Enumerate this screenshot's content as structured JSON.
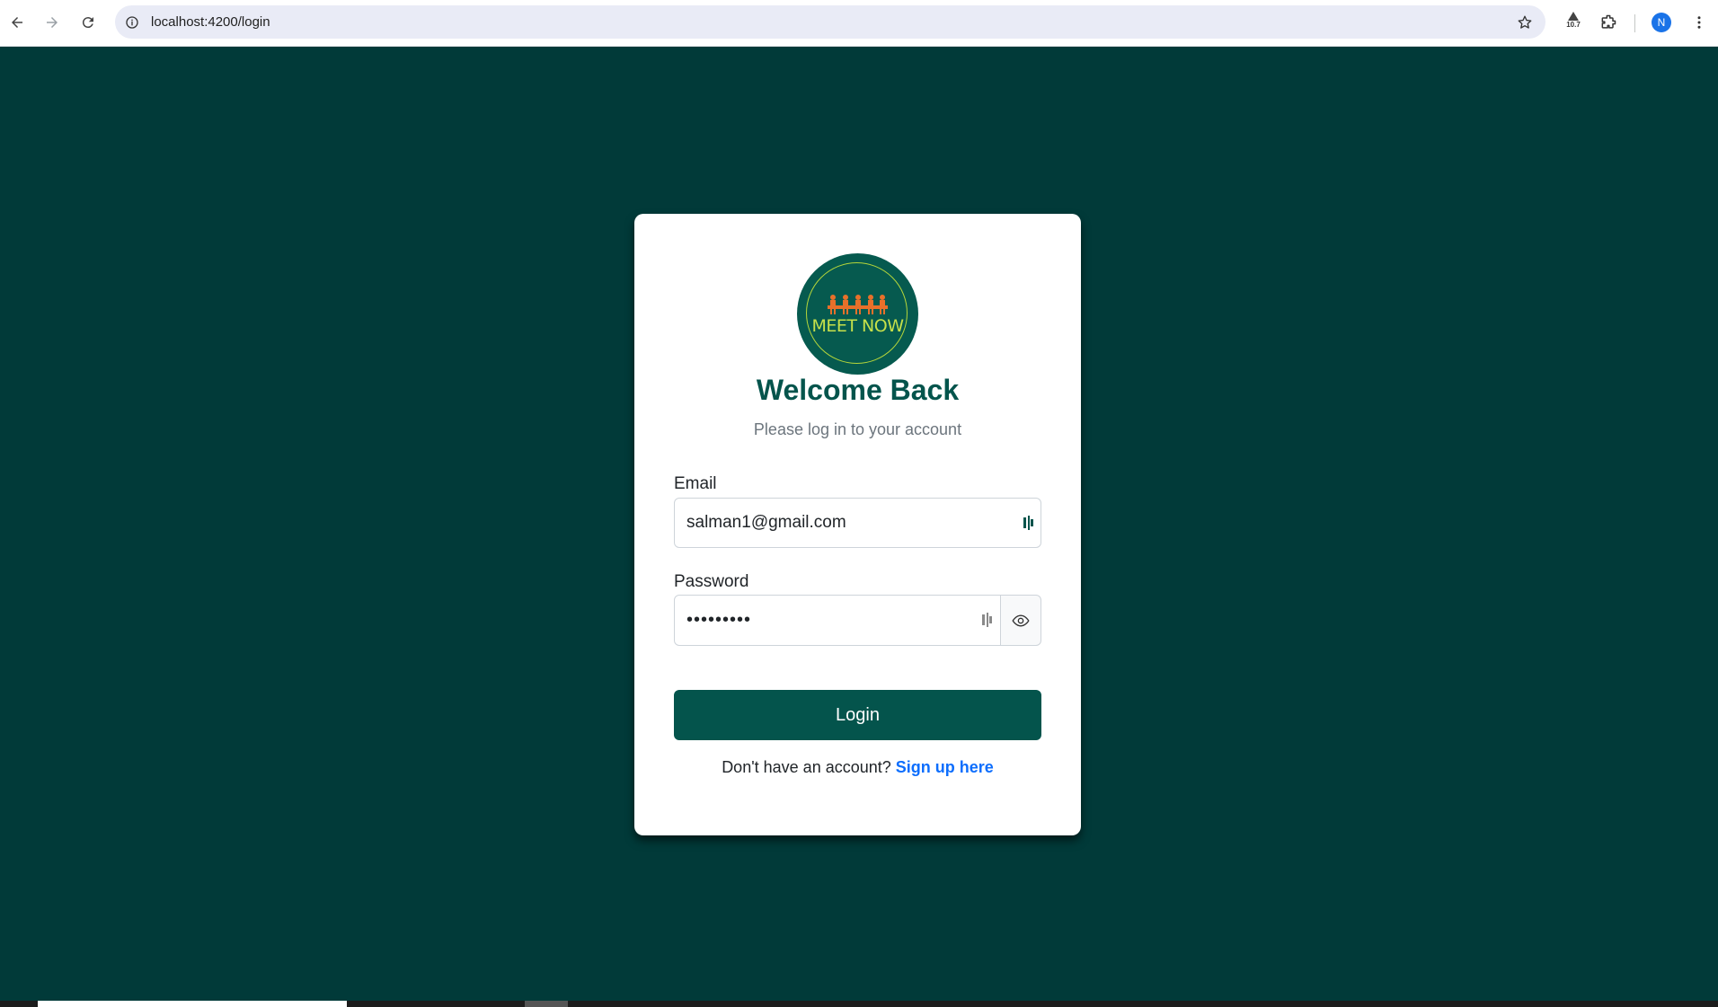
{
  "browser": {
    "url": "localhost:4200/login",
    "extension_badge": "10.7",
    "profile_initial": "N"
  },
  "logo": {
    "text": "MEET NOW"
  },
  "login": {
    "title": "Welcome Back",
    "subtitle": "Please log in to your account",
    "email_label": "Email",
    "email_value": "salman1@gmail.com",
    "password_label": "Password",
    "password_value": "•••••••••",
    "login_button": "Login",
    "signup_prompt": "Don't have an account?",
    "signup_link": "Sign up here"
  },
  "colors": {
    "page_background": "#013a39",
    "primary": "#04544c",
    "logo_background": "#065a4f",
    "logo_text": "#c6e04a",
    "link": "#0d6efd"
  }
}
